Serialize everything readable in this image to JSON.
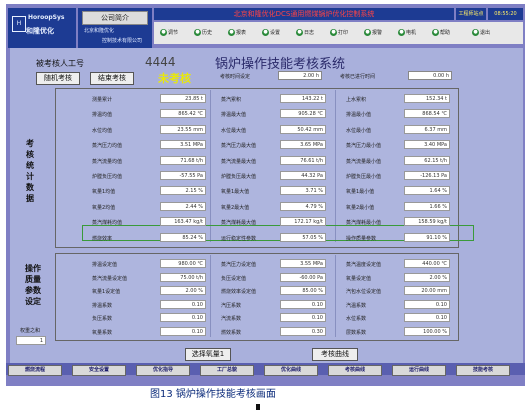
{
  "header": {
    "logo_brand": "HoroopSys",
    "logo_cn": "和隆优化",
    "company_button": "公司简介",
    "company_name_1": "北京和隆优化",
    "company_name_2": "控制技术有限公司",
    "system_title": "北京和隆优化DCS通用燃煤锅炉优化控制系统",
    "station": "工程师站点",
    "time": "08:55:20",
    "date": "2009-3-23"
  },
  "toolbar": [
    "调节",
    "历史",
    "报表",
    "设置",
    "日志",
    "打印",
    "报警",
    "电机",
    "帮助",
    "退出"
  ],
  "assessment": {
    "examinee_label": "被考核人工号",
    "examinee_id": "4444",
    "title": "锅炉操作技能考核系统",
    "random_btn": "随机考核",
    "end_btn": "结束考核",
    "status": "未考核",
    "assess_time_label": "考核时间设定",
    "assess_time_value": "2.00 h",
    "elapsed_label": "考核已进行时间",
    "elapsed_value": "0.00 h"
  },
  "stats_label": [
    "考",
    "核",
    "统",
    "计",
    "数",
    "据"
  ],
  "stats_rows": [
    [
      "测量累计",
      "23.85 t",
      "蒸汽累积",
      "143.22 t",
      "上水累积",
      "152.34 t"
    ],
    [
      "排温均值",
      "865.42 ℃",
      "排温最大值",
      "905.28 ℃",
      "排温最小值",
      "868.54 ℃"
    ],
    [
      "水位均值",
      "23.55 mm",
      "水位最大值",
      "50.42 mm",
      "水位最小值",
      "6.37 mm"
    ],
    [
      "蒸汽压力均值",
      "3.51 MPa",
      "蒸汽压力最大值",
      "3.65 MPa",
      "蒸汽压力最小值",
      "3.40 MPa"
    ],
    [
      "蒸汽流量均值",
      "71.68 t/h",
      "蒸汽流量最大值",
      "76.61 t/h",
      "蒸汽流量最小值",
      "62.15 t/h"
    ],
    [
      "炉膛负压均值",
      "-57.55 Pa",
      "炉膛负压最大值",
      "44.32 Pa",
      "炉膛负压最小值",
      "-126.13 Pa"
    ],
    [
      "氧量1均值",
      "2.15 %",
      "氧量1最大值",
      "3.71 %",
      "氧量1最小值",
      "1.64 %"
    ],
    [
      "氧量2均值",
      "2.44 %",
      "氧量2最大值",
      "4.79 %",
      "氧量2最小值",
      "1.66 %"
    ],
    [
      "蒸汽煤耗均值",
      "163.47 kg/t",
      "蒸汽煤耗最大值",
      "172.17 kg/t",
      "蒸汽煤耗最小值",
      "158.59 kg/t"
    ],
    [
      "燃烧效率",
      "85.24 %",
      "运行稳定性参数",
      "57.05 %",
      "操作质量参数",
      "91.10 %"
    ]
  ],
  "quality_label": [
    "操作",
    "质量",
    "参数",
    "设定"
  ],
  "weight_label": "权重之和",
  "weight_value": "1",
  "quality_rows": [
    [
      "排温设定值",
      "980.00 ℃",
      "蒸汽压力设定值",
      "3.55 MPa",
      "蒸汽温度设定值",
      "440.00 ℃"
    ],
    [
      "蒸汽流量设定值",
      "75.00 t/h",
      "负压设定值",
      "-60.00 Pa",
      "氧量设定值",
      "2.00 %"
    ],
    [
      "氧量1设定值",
      "2.00 %",
      "燃烧效率设定值",
      "85.00 %",
      "汽包水位设定值",
      "20.00 mm"
    ],
    [
      "排温系数",
      "0.10",
      "汽压系数",
      "0.10",
      "汽温系数",
      "0.10"
    ],
    [
      "负压系数",
      "0.10",
      "汽流系数",
      "0.10",
      "水位系数",
      "0.10"
    ],
    [
      "氧量系数",
      "0.10",
      "燃效系数",
      "0.30",
      "层数系数",
      "100.00 %"
    ]
  ],
  "bottom_buttons": {
    "select_oxygen": "选择氧量1",
    "curve": "考核曲线"
  },
  "nav": [
    "燃烧流程",
    "安全设置",
    "优化指导",
    "工厂总貌",
    "优化曲线",
    "考核曲线",
    "运行曲线",
    "技能考核"
  ],
  "caption": "图13 锅炉操作技能考核画面"
}
